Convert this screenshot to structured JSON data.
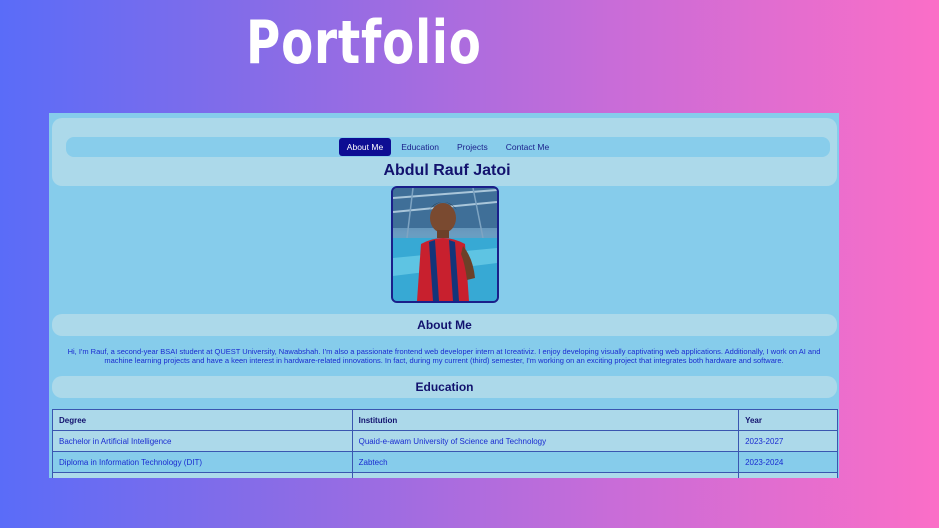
{
  "banner": {
    "title": "Portfolio"
  },
  "nav": {
    "items": [
      "About Me",
      "Education",
      "Projects",
      "Contact Me"
    ],
    "active": "About Me"
  },
  "profile": {
    "name": "Abdul Rauf Jatoi"
  },
  "about": {
    "heading": "About Me",
    "text": "Hi, I'm Rauf, a second-year BSAI student at QUEST University, Nawabshah. I'm also a passionate frontend web developer intern at Icreativiz. I enjoy developing visually captivating web applications. Additionally, I work on AI and machine learning projects and have a keen interest in hardware-related innovations. In fact, during my current (third) semester, I'm working on an exciting project that integrates both hardware and software."
  },
  "education": {
    "heading": "Education",
    "columns": [
      "Degree",
      "Institution",
      "Year"
    ],
    "rows": [
      [
        "Bachelor in Artificial Intelligence",
        "Quaid-e-awam University of Science and Technology",
        "2023-2027"
      ],
      [
        "Diploma in Information Technology (DIT)",
        "Zabtech",
        "2023-2024"
      ],
      [
        "",
        "",
        ""
      ]
    ]
  },
  "colors": {
    "accent": "#0d0d93",
    "section_bg": "#acd9ea",
    "page_bg": "#86cceb",
    "heading_text": "#12126e",
    "body_text": "#1a2bd0"
  }
}
